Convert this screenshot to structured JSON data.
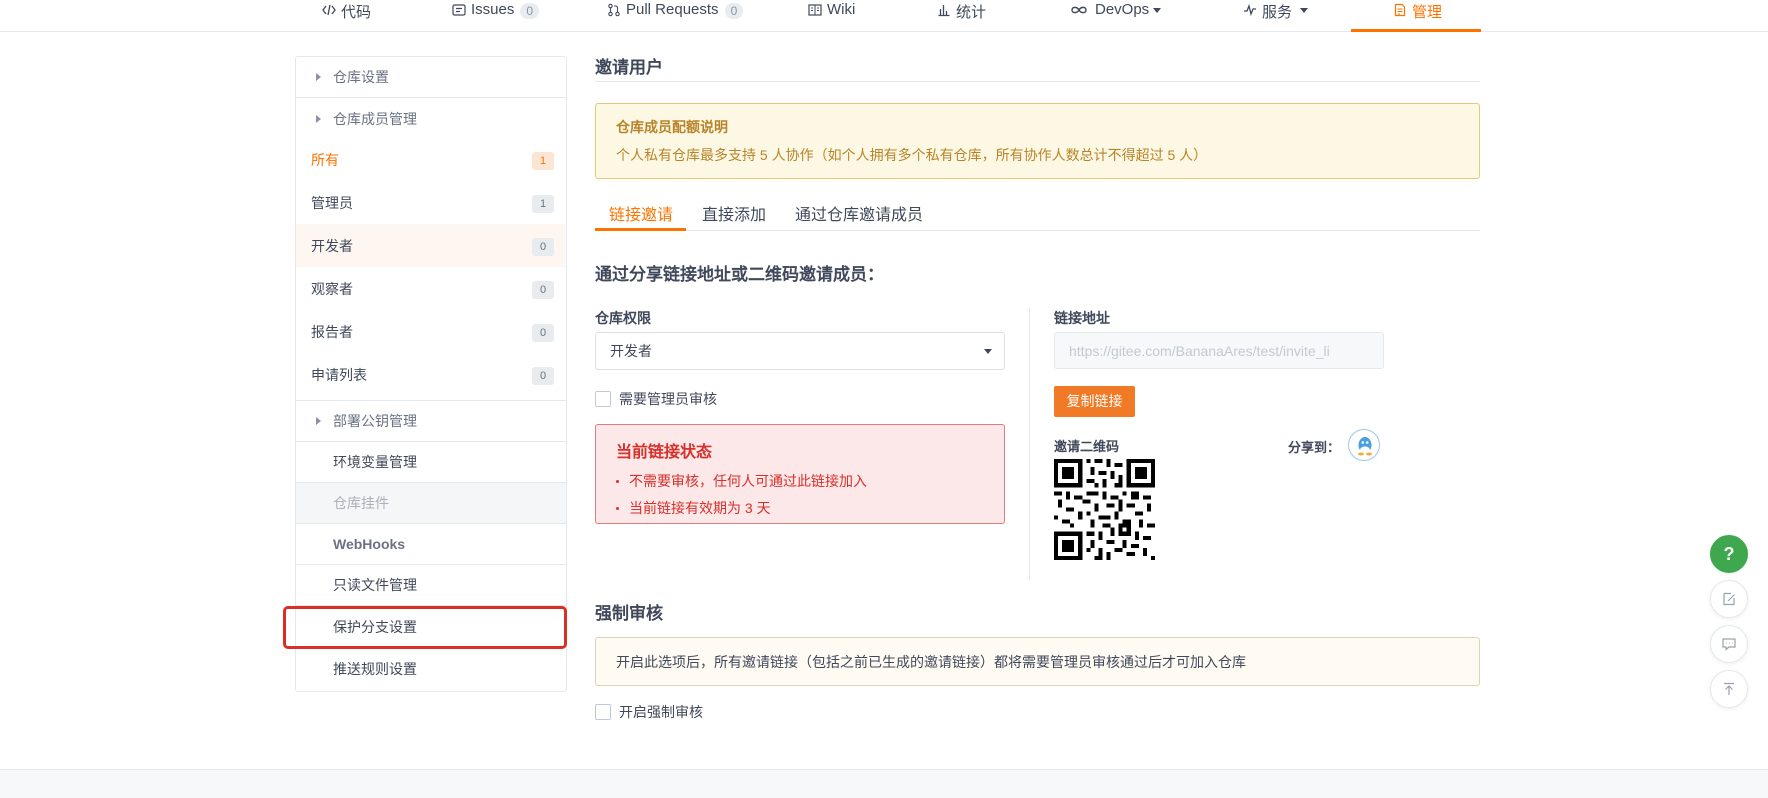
{
  "topnav": {
    "tabs": [
      {
        "label": "代码",
        "icon": "code-icon"
      },
      {
        "label": "Issues",
        "icon": "issues-icon",
        "count": "0"
      },
      {
        "label": "Pull Requests",
        "icon": "pull-request-icon",
        "count": "0"
      },
      {
        "label": "Wiki",
        "icon": "wiki-icon"
      },
      {
        "label": "统计",
        "icon": "stats-icon"
      },
      {
        "label": "DevOps",
        "icon": "devops-icon"
      },
      {
        "label": "服务",
        "icon": "service-icon"
      },
      {
        "label": "管理",
        "icon": "manage-icon",
        "active": true
      }
    ],
    "accent_color": "#fe7300"
  },
  "sidebar": {
    "repo_settings": "仓库设置",
    "member_management": "仓库成员管理",
    "members": [
      {
        "label": "所有",
        "count": "1"
      },
      {
        "label": "管理员",
        "count": "1"
      },
      {
        "label": "开发者",
        "count": "0"
      },
      {
        "label": "观察者",
        "count": "0"
      },
      {
        "label": "报告者",
        "count": "0"
      },
      {
        "label": "申请列表",
        "count": "0"
      }
    ],
    "deploy_keys": "部署公钥管理",
    "subitems": [
      {
        "label": "环境变量管理"
      },
      {
        "label": "仓库挂件"
      },
      {
        "label": "WebHooks"
      },
      {
        "label": "只读文件管理"
      },
      {
        "label": "保护分支设置"
      },
      {
        "label": "推送规则设置"
      }
    ]
  },
  "main": {
    "title": "邀请用户",
    "quota_notice": {
      "title": "仓库成员配额说明",
      "text": "个人私有仓库最多支持 5 人协作（如个人拥有多个私有仓库，所有协作人数总计不得超过 5 人）"
    },
    "tabs": [
      {
        "label": "链接邀请",
        "active": true
      },
      {
        "label": "直接添加"
      },
      {
        "label": "通过仓库邀请成员"
      }
    ],
    "invite_heading": "通过分享链接地址或二维码邀请成员：",
    "permission_label": "仓库权限",
    "permission_value": "开发者",
    "require_review_label": "需要管理员审核",
    "link_status": {
      "title": "当前链接状态",
      "items": [
        "不需要审核，任何人可通过此链接加入",
        "当前链接有效期为 3 天"
      ]
    },
    "link_label": "链接地址",
    "link_placeholder": "https://gitee.com/BananaAres/test/invite_li",
    "copy_button": "复制链接",
    "qr_label": "邀请二维码",
    "share_label": "分享到：",
    "force_review": {
      "title": "强制审核",
      "notice": "开启此选项后，所有邀请链接（包括之前已生成的邀请链接）都将需要管理员审核通过后才可加入仓库",
      "checkbox_label": "开启强制审核"
    }
  },
  "float_buttons": [
    {
      "label": "?",
      "icon": "help-icon"
    },
    {
      "icon": "edit-icon"
    },
    {
      "icon": "chat-icon"
    },
    {
      "icon": "back-to-top-icon"
    }
  ]
}
